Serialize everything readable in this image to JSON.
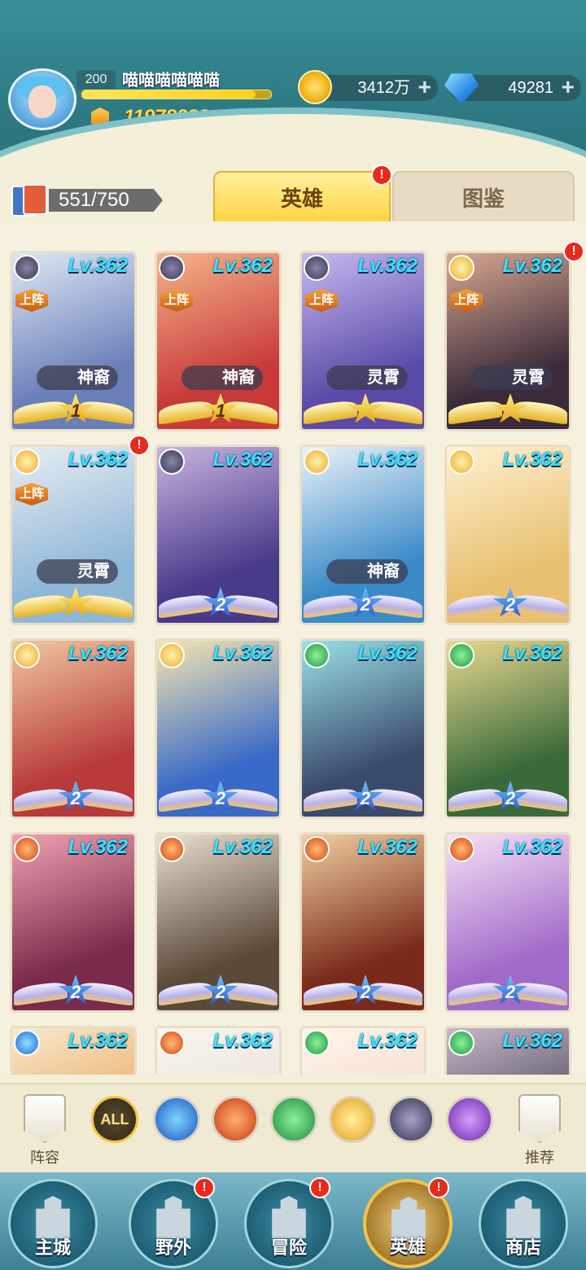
{
  "player": {
    "level": "200",
    "name": "喵喵喵喵喵喵",
    "xp_fraction": 0.92,
    "power": "11978288"
  },
  "resources": {
    "gold": "3412万",
    "gems": "49281"
  },
  "heroes_owned": "551/750",
  "tabs": [
    {
      "label": "英雄",
      "active": true,
      "badge": "!"
    },
    {
      "label": "图鉴",
      "active": false
    }
  ],
  "cards": [
    {
      "level": "Lv.362",
      "faction": "dark",
      "deployed": "上阵",
      "class": "神裔",
      "rank": "1",
      "wing": "gold",
      "badge": false,
      "art": [
        "#6a7fb8",
        "#dfe6f5"
      ]
    },
    {
      "level": "Lv.362",
      "faction": "dark",
      "deployed": "上阵",
      "class": "神裔",
      "rank": "1",
      "wing": "gold",
      "badge": false,
      "art": [
        "#c83a3a",
        "#f4b48a"
      ]
    },
    {
      "level": "Lv.362",
      "faction": "dark",
      "deployed": "上阵",
      "class": "灵霄",
      "rank": "",
      "wing": "gold",
      "badge": false,
      "art": [
        "#5b4aa8",
        "#c6b8ee"
      ]
    },
    {
      "level": "Lv.362",
      "faction": "light",
      "deployed": "上阵",
      "class": "灵霄",
      "rank": "",
      "wing": "gold",
      "badge": true,
      "art": [
        "#3a2a3a",
        "#d8a890"
      ]
    },
    {
      "level": "Lv.362",
      "faction": "light",
      "deployed": "上阵",
      "class": "灵霄",
      "rank": "",
      "wing": "gold",
      "badge": true,
      "art": [
        "#8fb7d8",
        "#e8eef2"
      ]
    },
    {
      "level": "Lv.362",
      "faction": "dark",
      "deployed": "",
      "class": "",
      "rank": "2",
      "wing": "blue",
      "badge": false,
      "art": [
        "#4a3a8a",
        "#c8b4e0"
      ]
    },
    {
      "level": "Lv.362",
      "faction": "light",
      "deployed": "",
      "class": "神裔",
      "rank": "2",
      "wing": "blue",
      "badge": false,
      "art": [
        "#3a8ac8",
        "#eaf2f8"
      ]
    },
    {
      "level": "Lv.362",
      "faction": "light",
      "deployed": "",
      "class": "",
      "rank": "2",
      "wing": "blue",
      "badge": false,
      "art": [
        "#e8c070",
        "#fff0d0"
      ]
    },
    {
      "level": "Lv.362",
      "faction": "light",
      "deployed": "",
      "class": "",
      "rank": "2",
      "wing": "blue",
      "badge": false,
      "art": [
        "#b83a3a",
        "#f0c8a0"
      ]
    },
    {
      "level": "Lv.362",
      "faction": "light",
      "deployed": "",
      "class": "",
      "rank": "2",
      "wing": "blue",
      "badge": false,
      "art": [
        "#3a6ac8",
        "#f5e6b0"
      ]
    },
    {
      "level": "Lv.362",
      "faction": "nature",
      "deployed": "",
      "class": "",
      "rank": "2",
      "wing": "blue",
      "badge": false,
      "art": [
        "#3a4a6a",
        "#9ae0e8"
      ]
    },
    {
      "level": "Lv.362",
      "faction": "nature",
      "deployed": "",
      "class": "",
      "rank": "2",
      "wing": "blue",
      "badge": false,
      "art": [
        "#3a6a3a",
        "#e8d890"
      ]
    },
    {
      "level": "Lv.362",
      "faction": "fire",
      "deployed": "",
      "class": "",
      "rank": "2",
      "wing": "blue",
      "badge": false,
      "art": [
        "#7a2a4a",
        "#f0a0b0"
      ]
    },
    {
      "level": "Lv.362",
      "faction": "fire",
      "deployed": "",
      "class": "",
      "rank": "2",
      "wing": "blue",
      "badge": false,
      "art": [
        "#5a4a3a",
        "#e8e0d0"
      ]
    },
    {
      "level": "Lv.362",
      "faction": "fire",
      "deployed": "",
      "class": "",
      "rank": "2",
      "wing": "blue",
      "badge": false,
      "art": [
        "#7a2a1a",
        "#f0d0a0"
      ]
    },
    {
      "level": "Lv.362",
      "faction": "fire",
      "deployed": "",
      "class": "",
      "rank": "2",
      "wing": "blue",
      "badge": false,
      "art": [
        "#a06ac8",
        "#f6e0f6"
      ]
    },
    {
      "level": "Lv.362",
      "faction": "water",
      "deployed": "",
      "class": "",
      "rank": "",
      "wing": "",
      "badge": false,
      "art": [
        "#e8a050",
        "#f8ead0"
      ]
    },
    {
      "level": "Lv.362",
      "faction": "fire",
      "deployed": "",
      "class": "",
      "rank": "",
      "wing": "",
      "badge": false,
      "art": [
        "#e8e0d8",
        "#f8f4ee"
      ]
    },
    {
      "level": "Lv.362",
      "faction": "nature",
      "deployed": "",
      "class": "",
      "rank": "",
      "wing": "",
      "badge": false,
      "art": [
        "#f0d8c8",
        "#fff4ea"
      ]
    },
    {
      "level": "Lv.362",
      "faction": "nature",
      "deployed": "",
      "class": "",
      "rank": "",
      "wing": "",
      "badge": false,
      "art": [
        "#3a3a4a",
        "#c8b8c8"
      ]
    }
  ],
  "filters": {
    "lineup_label": "阵容",
    "all_label": "ALL",
    "recommend_label": "推荐",
    "factions": [
      "water-faction-icon",
      "fire-faction-icon",
      "nature-faction-icon",
      "light-faction-icon",
      "dark-faction-icon",
      "arcane-faction-icon"
    ]
  },
  "nav": [
    {
      "label": "主城",
      "badge": false
    },
    {
      "label": "野外",
      "badge": true
    },
    {
      "label": "冒险",
      "badge": true
    },
    {
      "label": "英雄",
      "badge": true,
      "active": true
    },
    {
      "label": "商店",
      "badge": false
    }
  ],
  "colors": {
    "accent": "#ffd23c",
    "level_text": "#34e5ff",
    "badge": "#e8291c"
  }
}
